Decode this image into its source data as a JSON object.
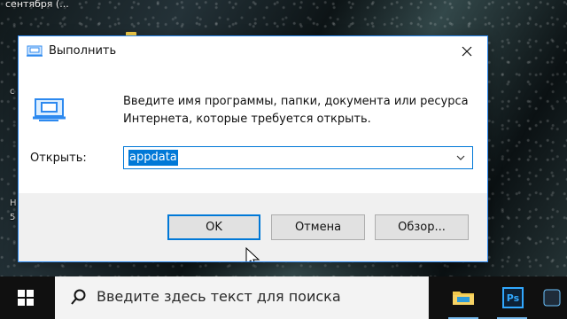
{
  "desktop": {
    "top_text": "сентября (...",
    "fragment1": "с",
    "fragment2": "Н",
    "fragment3": "5"
  },
  "dialog": {
    "title": "Выполнить",
    "description_line1": "Введите имя программы, папки, документа или ресурса",
    "description_line2": "Интернета, которые требуется открыть.",
    "open_label": "Открыть:",
    "input_value": "appdata",
    "buttons": {
      "ok": "OK",
      "cancel": "Отмена",
      "browse": "Обзор..."
    }
  },
  "taskbar": {
    "search_placeholder": "Введите здесь текст для поиска",
    "ps_label": "Ps"
  },
  "colors": {
    "accent": "#0078d7",
    "taskbar": "#101010",
    "dialog_bottom": "#f0f0f0",
    "photoshop_blue": "#31a8ff"
  },
  "icons": {
    "title": "run-icon",
    "main": "run-icon",
    "close": "close-icon",
    "dropdown": "chevron-down-icon",
    "start": "windows-icon",
    "search": "search-icon",
    "folder": "folder-icon",
    "photoshop": "photoshop-icon",
    "cursor": "cursor-icon"
  }
}
